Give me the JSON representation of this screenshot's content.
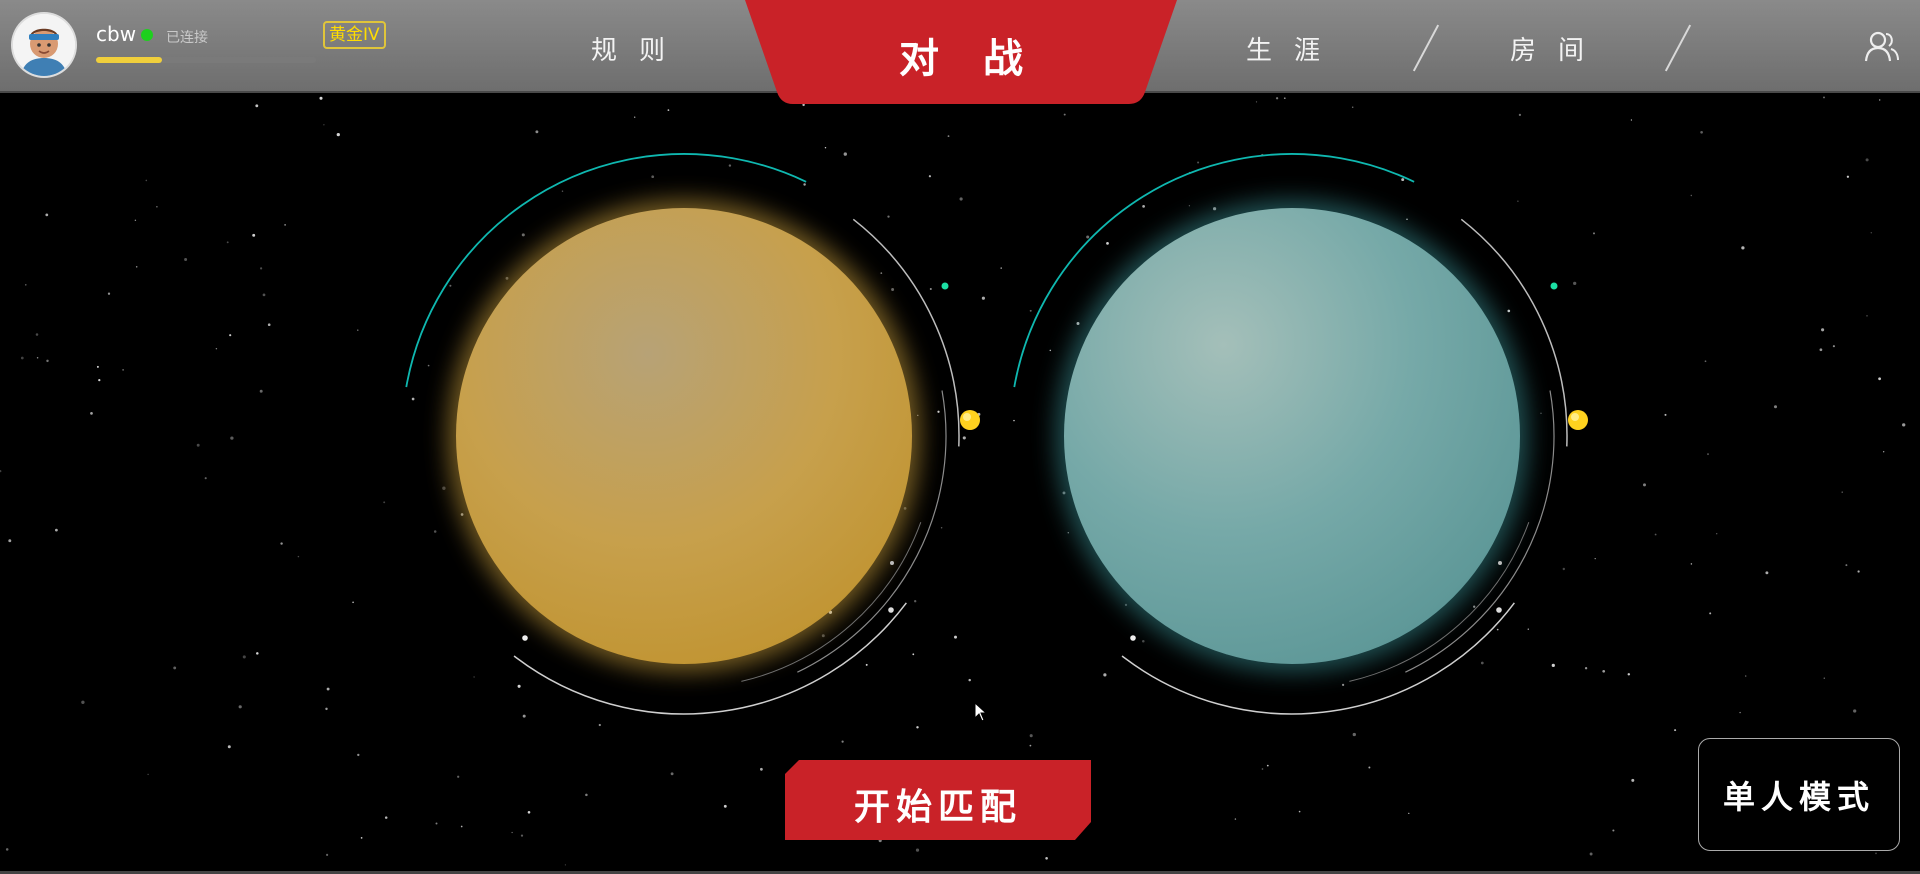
{
  "user": {
    "name": "cbw",
    "status": "已连接",
    "rank": "黄金IV",
    "xp_progress": 0.3
  },
  "nav": {
    "rules": "规则",
    "battle": "对战",
    "career": "生涯",
    "room": "房间"
  },
  "actions": {
    "start_match": "开始匹配",
    "single_mode": "单人模式"
  },
  "icons": {
    "avatar": "avatar-icon",
    "profile": "user-profile-icon",
    "cursor": "mouse-cursor-icon"
  },
  "colors": {
    "accent_red": "#c92228",
    "orb_gold": "#c9a24c",
    "orb_teal": "#6fa7a6",
    "rank_gold": "#ffdc00",
    "online_green": "#1ed01e"
  }
}
